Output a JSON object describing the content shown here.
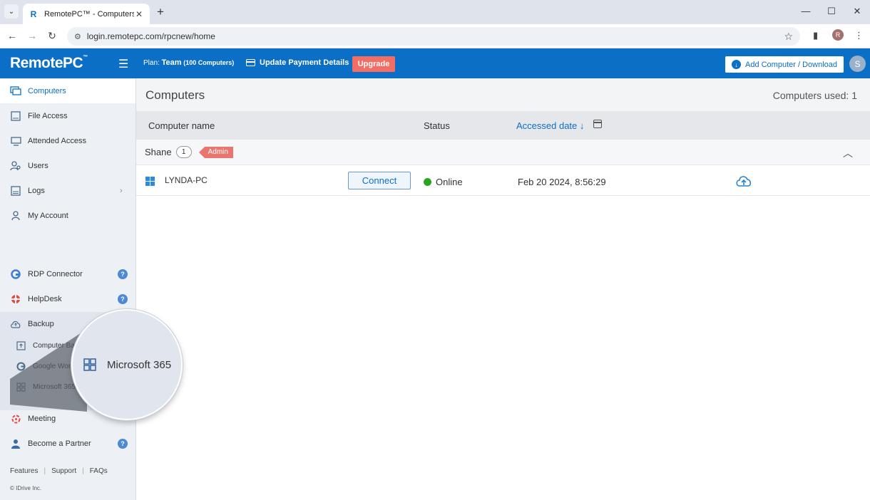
{
  "browser": {
    "tab_title": "RemotePC™ - Computers",
    "url": "login.remotepc.com/rpcnew/home",
    "profile_initial": "R"
  },
  "header": {
    "logo": "RemotePC",
    "logo_tm": "™",
    "plan_prefix": "Plan:",
    "plan_name": "Team",
    "plan_detail": "(100 Computers)",
    "update_payment": "Update Payment Details",
    "upgrade": "Upgrade",
    "add_computer": "Add Computer / Download",
    "avatar_initial": "S",
    "brand_color": "#0b6fc6"
  },
  "sidebar": {
    "computers": "Computers",
    "file_access": "File Access",
    "attended_access": "Attended Access",
    "users": "Users",
    "logs": "Logs",
    "my_account": "My Account",
    "rdp_connector": "RDP Connector",
    "helpdesk": "HelpDesk",
    "backup": "Backup",
    "computer_backup": "Computer Backup",
    "google_workspace": "Google Workspace",
    "microsoft_365": "Microsoft 365",
    "meeting": "Meeting",
    "become_partner": "Become a Partner",
    "footer": {
      "features": "Features",
      "support": "Support",
      "faqs": "FAQs",
      "copyright": "© IDrive Inc."
    }
  },
  "main": {
    "title": "Computers",
    "used": "Computers used: 1",
    "columns": {
      "name": "Computer name",
      "status": "Status",
      "accessed": "Accessed date ↓"
    },
    "group": {
      "name": "Shane",
      "count": "1",
      "tag": "Admin"
    },
    "rows": [
      {
        "name": "LYNDA-PC",
        "action": "Connect",
        "status": "Online",
        "accessed": "Feb 20 2024, 8:56:29"
      }
    ]
  },
  "magnifier": {
    "label": "Microsoft 365"
  }
}
